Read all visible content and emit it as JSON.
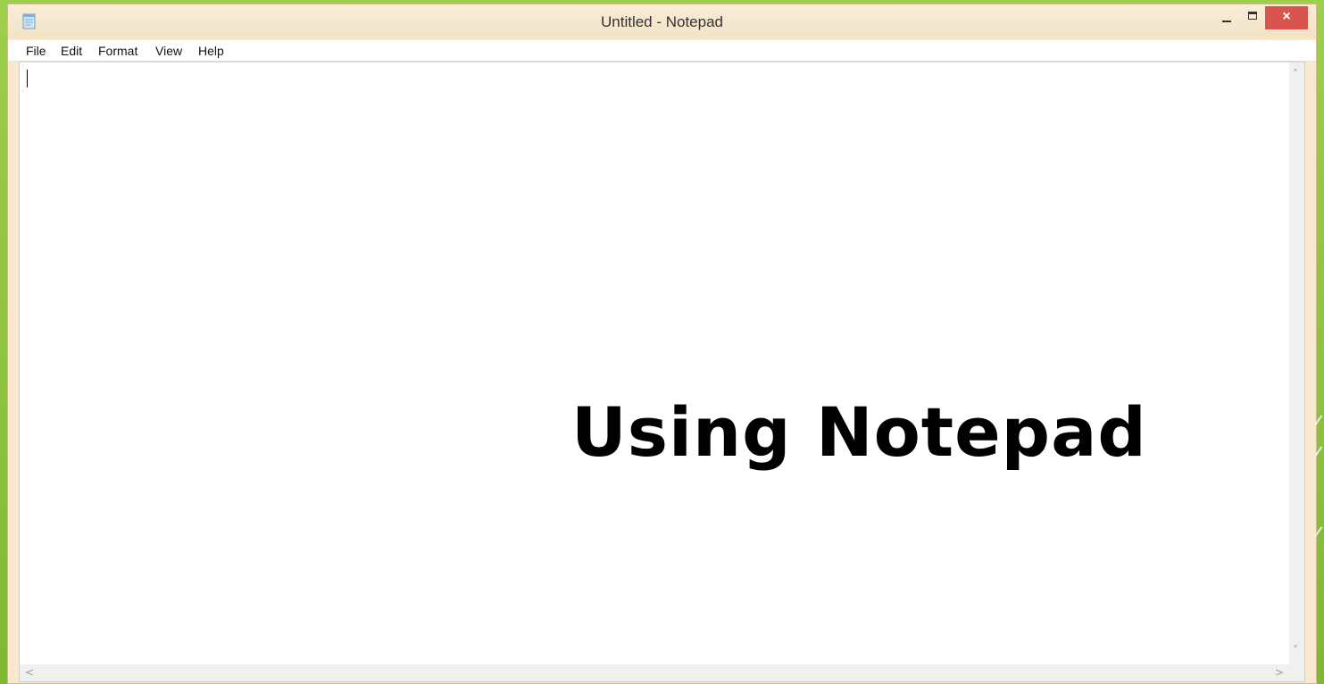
{
  "window": {
    "title": "Untitled - Notepad",
    "close_symbol": "×"
  },
  "menu": {
    "items": [
      "File",
      "Edit",
      "Format",
      "View",
      "Help"
    ]
  },
  "editor": {
    "content": ""
  },
  "slide": {
    "heading": "Using Notepad"
  },
  "icons": {
    "app": "notepad-icon",
    "minimize": "minimize-icon",
    "maximize": "maximize-icon",
    "close": "close-icon",
    "scroll_up": "chevron-up-icon",
    "scroll_down": "chevron-down-icon",
    "scroll_left": "chevron-left-icon",
    "scroll_right": "chevron-right-icon"
  },
  "colors": {
    "background": "#8cc63e",
    "titlebar": "#f7e9cf",
    "close_button": "#d9534f"
  }
}
